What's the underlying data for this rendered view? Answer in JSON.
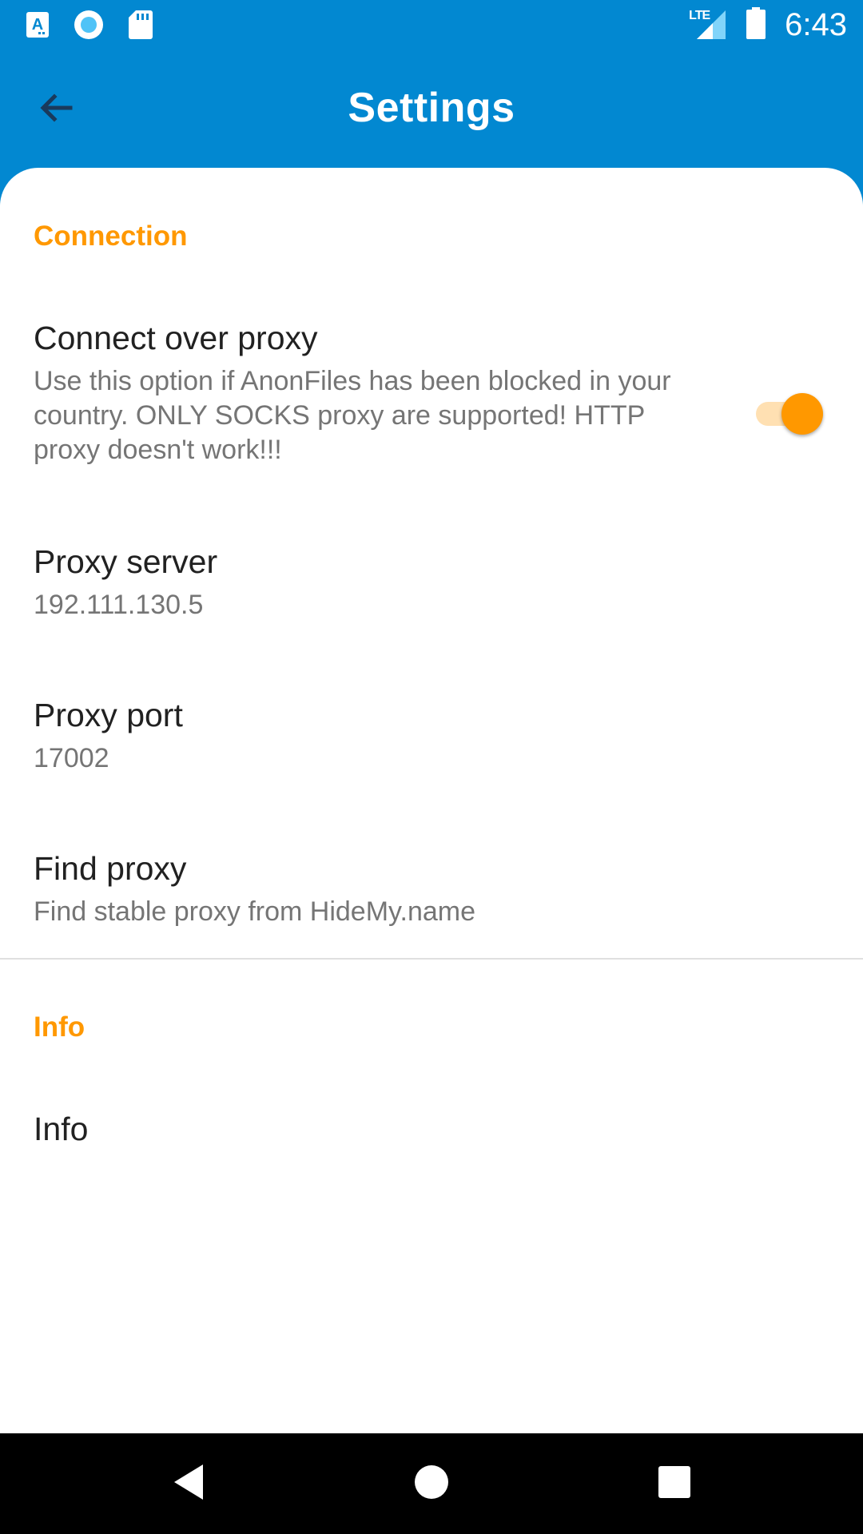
{
  "status_bar": {
    "time": "6:43",
    "network_label": "LTE",
    "left_icons": [
      "text-notification-icon",
      "record-icon",
      "sd-card-icon"
    ],
    "right_icons": [
      "lte-signal-icon",
      "battery-icon"
    ]
  },
  "app_bar": {
    "title": "Settings",
    "back_icon": "arrow-back-icon",
    "color": "#0288D1"
  },
  "sections": {
    "connection": {
      "header": "Connection",
      "connect_over_proxy": {
        "title": "Connect over proxy",
        "summary": "Use this option if AnonFiles has been blocked in your country. ONLY SOCKS proxy are supported! HTTP proxy doesn't work!!!",
        "enabled": true
      },
      "proxy_server": {
        "title": "Proxy server",
        "value": "192.111.130.5"
      },
      "proxy_port": {
        "title": "Proxy port",
        "value": "17002"
      },
      "find_proxy": {
        "title": "Find proxy",
        "summary": "Find stable proxy from HideMy.name"
      }
    },
    "info": {
      "header": "Info",
      "info_item": {
        "title": "Info"
      }
    }
  },
  "nav_bar": {
    "icons": [
      "back-triangle-icon",
      "home-circle-icon",
      "recents-square-icon"
    ]
  },
  "colors": {
    "accent": "#FF9800",
    "accent_light": "#FFE0B2",
    "primary": "#0288D1",
    "title_text": "#212121",
    "summary_text": "#757575"
  }
}
